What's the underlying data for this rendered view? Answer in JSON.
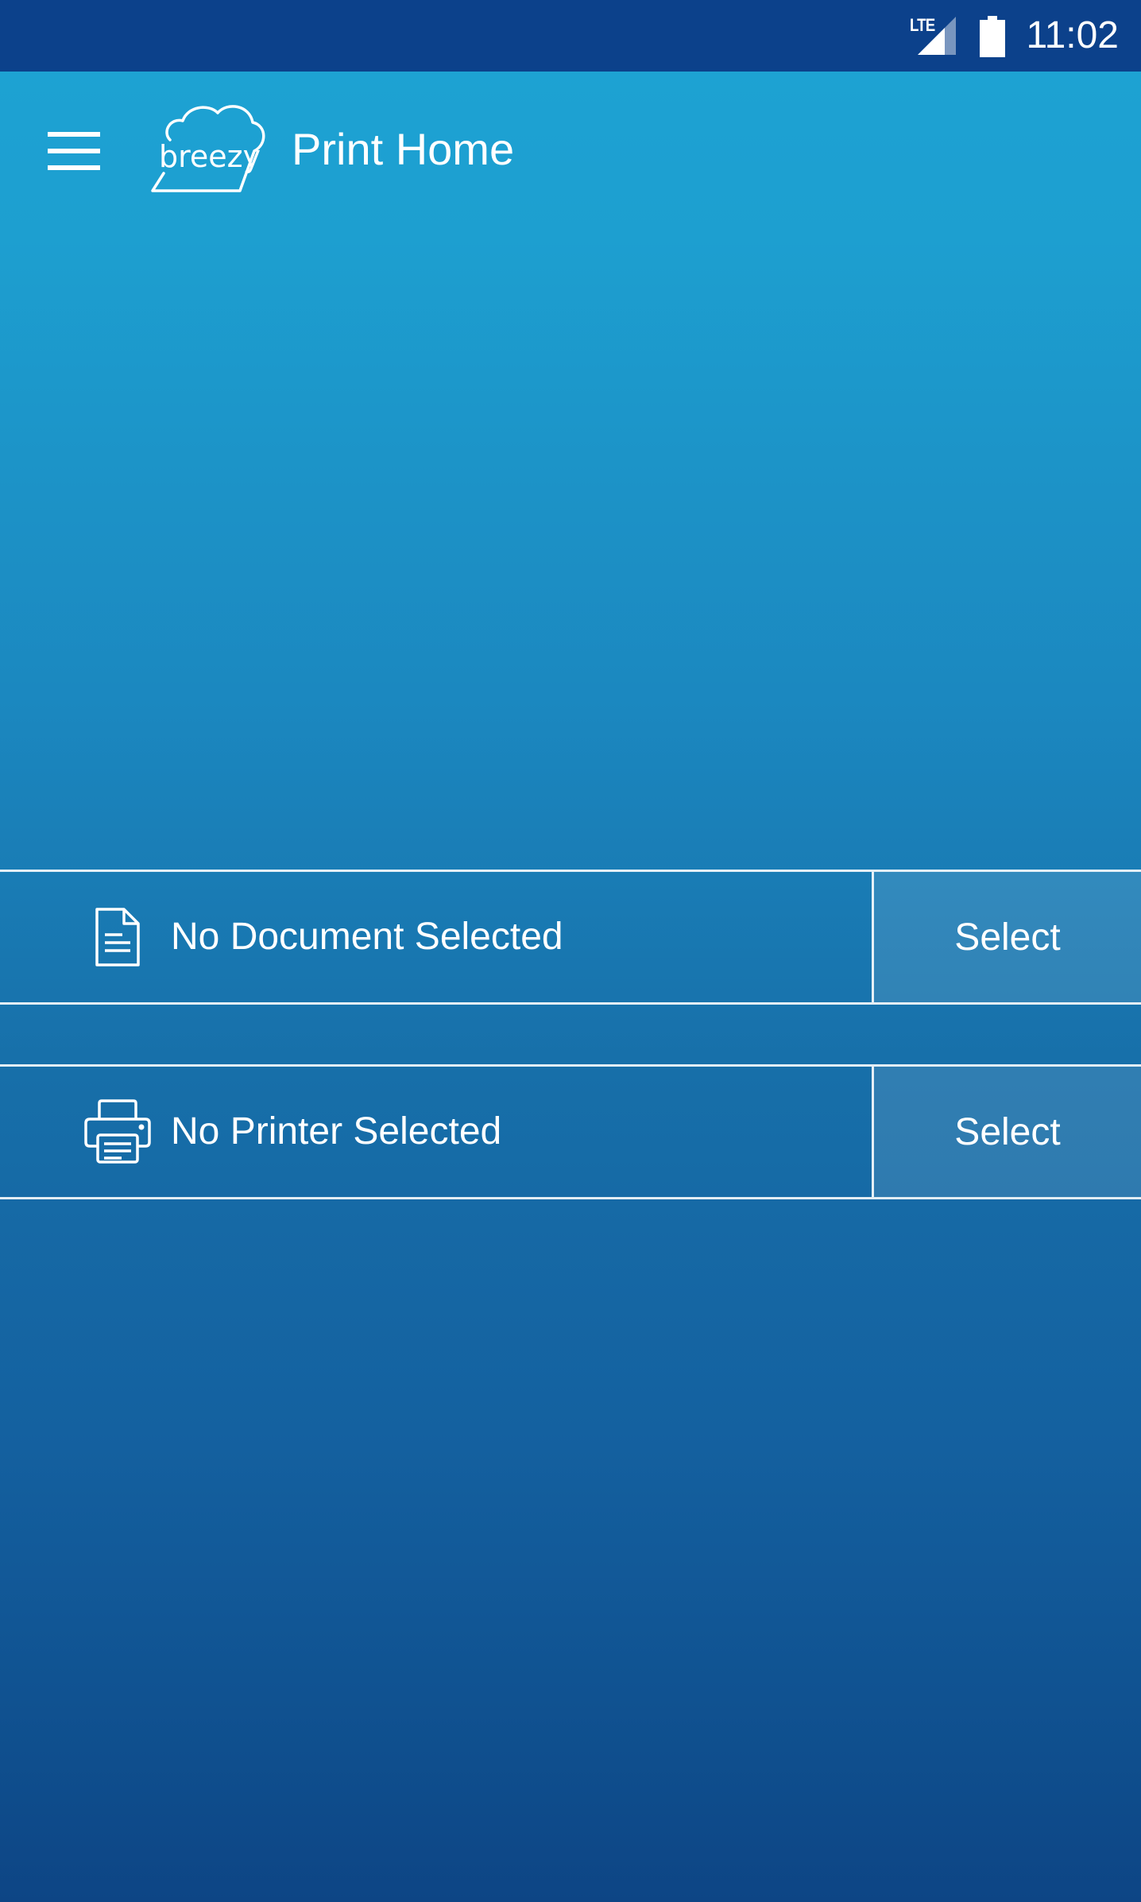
{
  "status_bar": {
    "network_label": "LTE",
    "time": "11:02",
    "icons": [
      "lte-signal-icon",
      "battery-icon"
    ]
  },
  "app_bar": {
    "menu_icon": "hamburger-menu-icon",
    "logo_text": "breezy",
    "title": "Print Home"
  },
  "selections": {
    "document": {
      "icon": "document-icon",
      "label": "No Document Selected",
      "button_label": "Select"
    },
    "printer": {
      "icon": "printer-icon",
      "label": "No Printer Selected",
      "button_label": "Select"
    }
  },
  "colors": {
    "status_bar": "#0c418b",
    "gradient_top": "#1da3d4",
    "gradient_bottom": "#0d4585",
    "divider": "#ffffff"
  }
}
